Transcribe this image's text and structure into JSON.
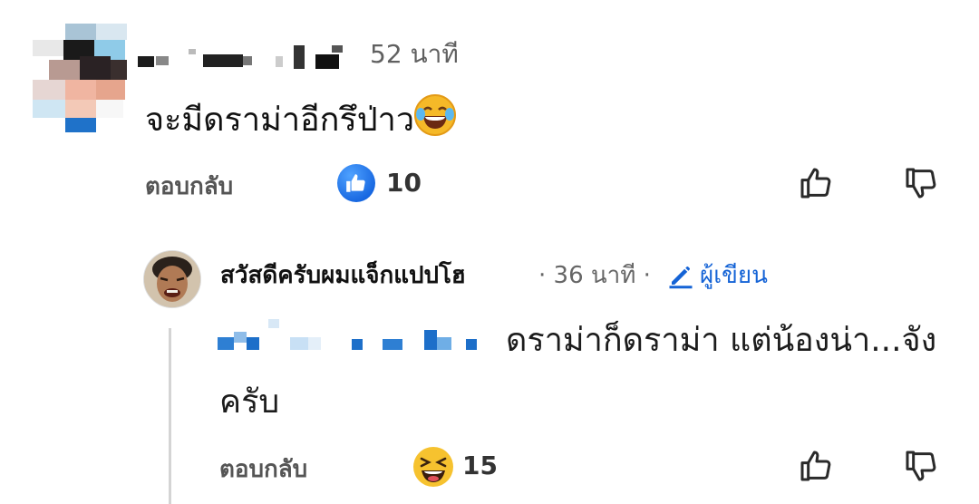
{
  "comment1": {
    "time": "52 นาที",
    "text": "จะมีดราม่าอีกรึป่าว",
    "emoji_icon": "tears-of-joy-emoji",
    "reply_label": "ตอบกลับ",
    "reaction_icon": "like-reaction-icon",
    "reaction_count": "10"
  },
  "comment2": {
    "author": "สวัสดีครับผมแจ็กแปปโฮ",
    "separator": "·",
    "time": "36 นาที",
    "author_badge": "ผู้เขียน",
    "text_line1": "ดราม่าก็ดราม่า แต่น้องน่า...จัง",
    "text_line2": "ครับ",
    "reply_label": "ตอบกลับ",
    "reaction_icon": "laughing-reaction-icon",
    "reaction_count": "15"
  },
  "colors": {
    "link_blue": "#1463d6",
    "like_blue": "#1666e0",
    "emoji_yellow": "#f5b928",
    "muted_text": "#606060"
  }
}
